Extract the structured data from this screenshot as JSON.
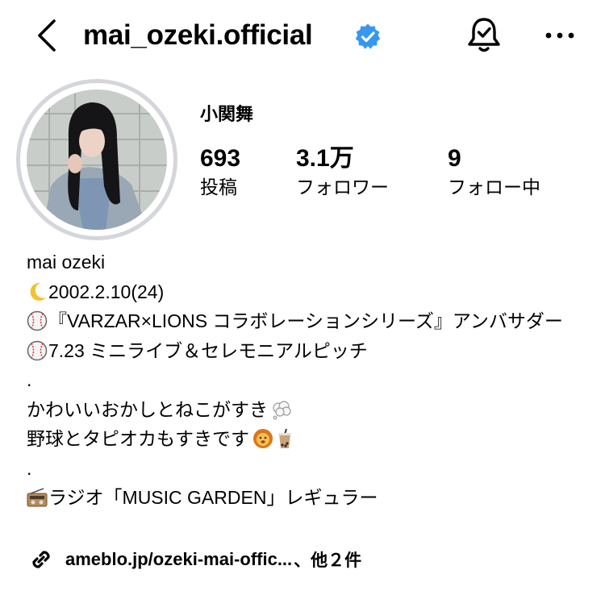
{
  "header": {
    "username": "mai_ozeki.official",
    "verified_icon": "verified-badge-icon",
    "accent_color": "#3797f0"
  },
  "profile": {
    "display_name": "小関舞",
    "stats": [
      {
        "value": "693",
        "label": "投稿"
      },
      {
        "value": "3.1万",
        "label": "フォロワー"
      },
      {
        "value": "9",
        "label": "フォロー中"
      }
    ]
  },
  "bio": {
    "lines": [
      "mai ozeki",
      "2002.2.10(24)",
      "『VARZAR×LIONS コラボレーションシリーズ』アンバサダー",
      "7.23 ミニライブ＆セレモニアルピッチ",
      ".",
      "かわいいおかしとねこがすき",
      "野球とタピオカもすきです",
      ".",
      "ラジオ「MUSIC GARDEN」レギュラー"
    ]
  },
  "link": {
    "url_text": "ameblo.jp/ozeki-mai-offic...",
    "more_text": "、他２件"
  }
}
